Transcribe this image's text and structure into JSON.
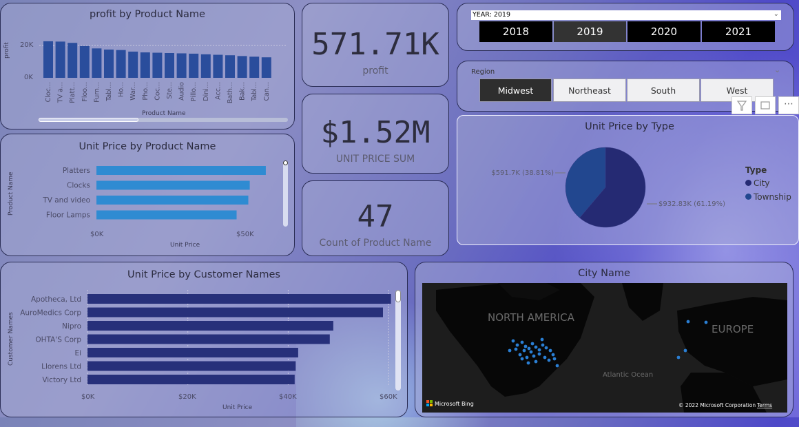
{
  "colors": {
    "bar_dark": "#27307a",
    "bar_mid": "#2a4d9c",
    "bar_light": "#2f8bd2",
    "pie_city": "#252a73",
    "pie_township": "#22478f",
    "map_bg": "#1a1a1a",
    "map_land": "#0b0b0b"
  },
  "profit_chart": {
    "title": "profit by Product Name",
    "ylabel": "profit",
    "xlabel": "Product Name",
    "ticks": [
      "20K",
      "0K"
    ],
    "chart_data": {
      "type": "bar",
      "categories": [
        "Cloc...",
        "TV a...",
        "Platt...",
        "Floo...",
        "Furn...",
        "Tabl...",
        "Ho...",
        "War...",
        "Pho...",
        "Coc...",
        "Ste...",
        "Audio",
        "Pillo...",
        "Dini...",
        "Acc...",
        "Bath...",
        "Bak...",
        "Tabl...",
        "Can..."
      ],
      "values": [
        23000,
        22800,
        22000,
        20000,
        18500,
        17800,
        17500,
        16500,
        16000,
        15800,
        15600,
        15400,
        15200,
        14800,
        14500,
        14200,
        13700,
        13300,
        12900
      ],
      "ylim": [
        0,
        26000
      ]
    }
  },
  "unit_price_product": {
    "title": "Unit Price by Product Name",
    "ylabel": "Product Name",
    "xlabel": "Unit Price",
    "ticks": [
      "$0K",
      "$50K"
    ],
    "chart_data": {
      "type": "bar",
      "categories": [
        "Platters",
        "Clocks",
        "TV and video",
        "Floor Lamps"
      ],
      "values": [
        58000,
        52500,
        52000,
        48000
      ],
      "xlim": [
        0,
        50000
      ]
    }
  },
  "kpis": [
    {
      "value": "571.71K",
      "label": "profit"
    },
    {
      "value": "$1.52M",
      "label": "UNIT PRICE SUM"
    },
    {
      "value": "47",
      "label": "Count of Product Name"
    }
  ],
  "year_slicer": {
    "header": "YEAR: 2019",
    "options": [
      "2018",
      "2019",
      "2020",
      "2021"
    ],
    "selected": "2019"
  },
  "region_slicer": {
    "header": "Region",
    "options": [
      "Midwest",
      "Northeast",
      "South",
      "West"
    ],
    "selected": "Midwest"
  },
  "unit_price_type": {
    "title": "Unit Price by Type",
    "legend_title": "Type",
    "chart_data": {
      "type": "pie",
      "slices": [
        {
          "name": "City",
          "value": 932830,
          "label": "$932.83K (61.19%)"
        },
        {
          "name": "Township",
          "value": 591700,
          "label": "$591.7K (38.81%)"
        }
      ]
    }
  },
  "unit_price_customer": {
    "title": "Unit Price by Customer Names",
    "ylabel": "Customer Names",
    "xlabel": "Unit Price",
    "ticks": [
      "$0K",
      "$20K",
      "$40K",
      "$60K"
    ],
    "chart_data": {
      "type": "bar",
      "categories": [
        "Apotheca, Ltd",
        "AuroMedics Corp",
        "Nipro",
        "OHTA'S Corp",
        "Ei",
        "Llorens Ltd",
        "Victory Ltd"
      ],
      "values": [
        60500,
        58900,
        49000,
        48300,
        42000,
        41500,
        41300
      ],
      "xlim": [
        0,
        60000
      ]
    }
  },
  "map": {
    "title": "City Name",
    "labels": {
      "north_america": "NORTH AMERICA",
      "europe": "EUROPE",
      "atlantic": "Atlantic Ocean"
    },
    "attribution": "© 2022 Microsoft Corporation",
    "terms": "Terms",
    "logo": "Microsoft Bing"
  }
}
